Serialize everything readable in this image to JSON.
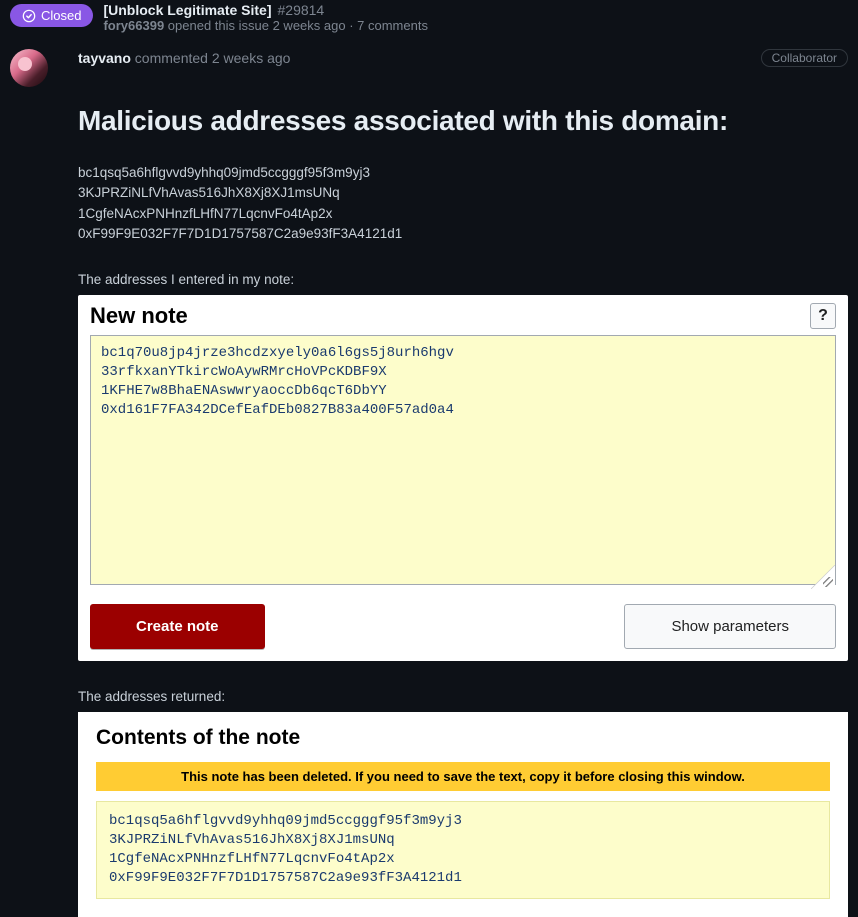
{
  "issue": {
    "status": "Closed",
    "title": "[Unblock Legitimate Site]",
    "number": "#29814",
    "opened_by": "fory66399",
    "opened_text": " opened this issue 2 weeks ago · 7 comments"
  },
  "comment": {
    "author": "tayvano",
    "verb": " commented 2 weeks ago",
    "badge": "Collaborator"
  },
  "section_heading": "Malicious addresses associated with this domain:",
  "addresses": [
    "bc1qsq5a6hflgvvd9yhhq09jmd5ccgggf95f3m9yj3",
    "3KJPRZiNLfVhAvas516JhX8Xj8XJ1msUNq",
    "1CgfeNAcxPNHnzfLHfN77LqcnvFo4tAp2x",
    "0xF99F9E032F7F7D1D1757587C2a9e93fF3A4121d1"
  ],
  "entered_label": "The addresses I entered in my note:",
  "new_note": {
    "title": "New note",
    "help": "?",
    "textarea": "bc1q70u8jp4jrze3hcdzxyely0a6l6gs5j8urh6hgv\n33rfkxanYTkircWoAywRMrcHoVPcKDBF9X\n1KFHE7w8BhaENAswwryaoccDb6qcT6DbYY\n0xd161F7FA342DCefEafDEb0827B83a400F57ad0a4",
    "create": "Create note",
    "show_params": "Show parameters"
  },
  "returned_label": "The addresses returned:",
  "contents": {
    "title": "Contents of the note",
    "banner": "This note has been deleted. If you need to save the text, copy it before closing this window.",
    "text": "bc1qsq5a6hflgvvd9yhhq09jmd5ccgggf95f3m9yj3\n3KJPRZiNLfVhAvas516JhX8Xj8XJ1msUNq\n1CgfeNAcxPNHnzfLHfN77LqcnvFo4tAp2x\n0xF99F9E032F7F7D1D1757587C2a9e93fF3A4121d1"
  }
}
